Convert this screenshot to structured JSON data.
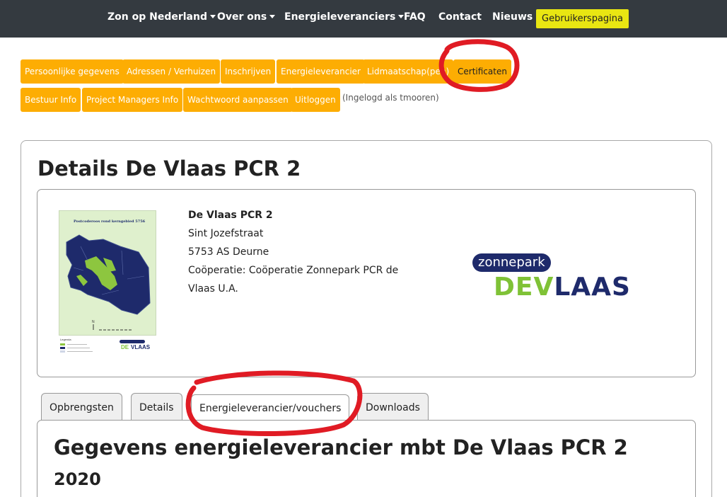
{
  "nav": {
    "items": [
      {
        "label": "Zon op Nederland",
        "dropdown": true
      },
      {
        "label": "Over ons",
        "dropdown": true
      },
      {
        "label": "Energieleveranciers",
        "dropdown": true
      },
      {
        "label": "FAQ",
        "dropdown": false
      },
      {
        "label": "Contact",
        "dropdown": false
      },
      {
        "label": "Nieuws",
        "dropdown": false
      }
    ],
    "user_button": "Gebruikerspagina"
  },
  "account_menu": {
    "row1": [
      "Persoonlijke gegevens",
      "Adressen / Verhuizen",
      "Inschrijven",
      "Energieleverancier",
      "Lidmaatschap(pen)",
      "Certificaten"
    ],
    "row2": [
      "Bestuur Info",
      "Project Managers Info",
      "Wachtwoord aanpassen",
      "Uitloggen"
    ],
    "logged_in_text": "(Ingelogd als tmooren)",
    "active": "Certificaten"
  },
  "details": {
    "title": "Details De Vlaas PCR 2",
    "project_name": "De Vlaas PCR 2",
    "street": "Sint Jozefstraat",
    "postal_city": "5753 AS Deurne",
    "cooperative_line1": "Coöperatie: Coöperatie Zonnepark PCR de",
    "cooperative_line2": "Vlaas U.A.",
    "map_title": "Postcoderoos rond kerngebied 5756",
    "map_legend": "Legenda"
  },
  "logo": {
    "top": "zonnepark",
    "main_green": "DEV",
    "main_blue": "LAAS"
  },
  "tabs": [
    {
      "label": "Opbrengsten"
    },
    {
      "label": "Details"
    },
    {
      "label": "Energieleverancier/vouchers"
    },
    {
      "label": "Downloads"
    }
  ],
  "active_tab": "Energieleverancier/vouchers",
  "panel": {
    "title": "Gegevens energieleverancier mbt De Vlaas PCR 2",
    "year": "2020"
  },
  "colors": {
    "nav_bg": "#343a40",
    "orange": "#fdad03",
    "user_btn": "#e9e612",
    "annotation": "#e01b24",
    "logo_green": "#7fc236",
    "logo_blue": "#1e2a6b"
  }
}
